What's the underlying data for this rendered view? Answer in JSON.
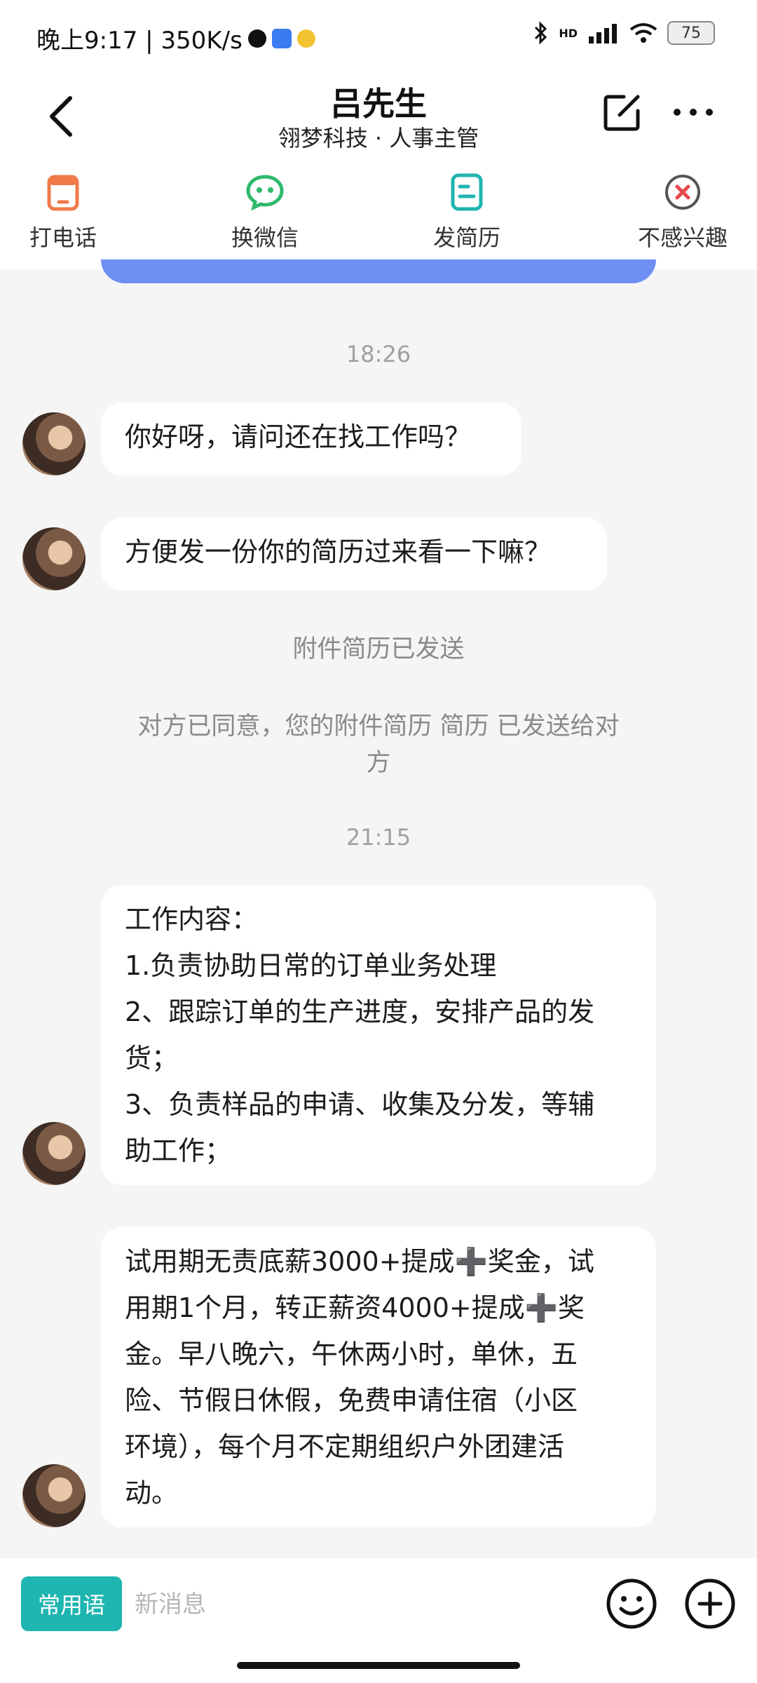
{
  "status_bar": {
    "time_speed": "晚上9:17 | 350K/s",
    "battery": "75",
    "network": "HD"
  },
  "header": {
    "title": "吕先生",
    "subtitle": "翎梦科技 · 人事主管"
  },
  "actions": [
    {
      "label": "打电话",
      "icon": "phone-icon",
      "color": "#f07a4a"
    },
    {
      "label": "换微信",
      "icon": "wechat-icon",
      "color": "#2fb96b"
    },
    {
      "label": "发简历",
      "icon": "resume-icon",
      "color": "#1fb5b0"
    },
    {
      "label": "不感兴趣",
      "icon": "close-circle-icon",
      "color": "#e8474c"
    }
  ],
  "chat": {
    "time1": "18:26",
    "msg1": "你好呀，请问还在找工作吗？",
    "msg2": "方便发一份你的简历过来看一下嘛？",
    "system1": "附件简历已发送",
    "system2_line1": "对方已同意，您的附件简历 简历 已发送给对",
    "system2_line2": "方",
    "time2": "21:15",
    "msg3": [
      "工作内容：",
      "1.负责协助日常的订单业务处理",
      "2、跟踪订单的生产进度，安排产品的发",
      "货；",
      "3、负责样品的申请、收集及分发，等辅",
      "助工作；"
    ],
    "msg4": [
      "试用期无责底薪3000+提成➕奖金，试",
      "用期1个月，转正薪资4000+提成➕奖",
      "金。早八晚六，午休两小时，单休，五",
      "险、节假日休假，免费申请住宿（小区",
      "环境），每个月不定期组织户外团建活",
      "动。"
    ]
  },
  "input": {
    "phrases_label": "常用语",
    "placeholder": "新消息"
  },
  "colors": {
    "accent": "#1fb5b0",
    "blue_card": "#6f8ff5"
  }
}
